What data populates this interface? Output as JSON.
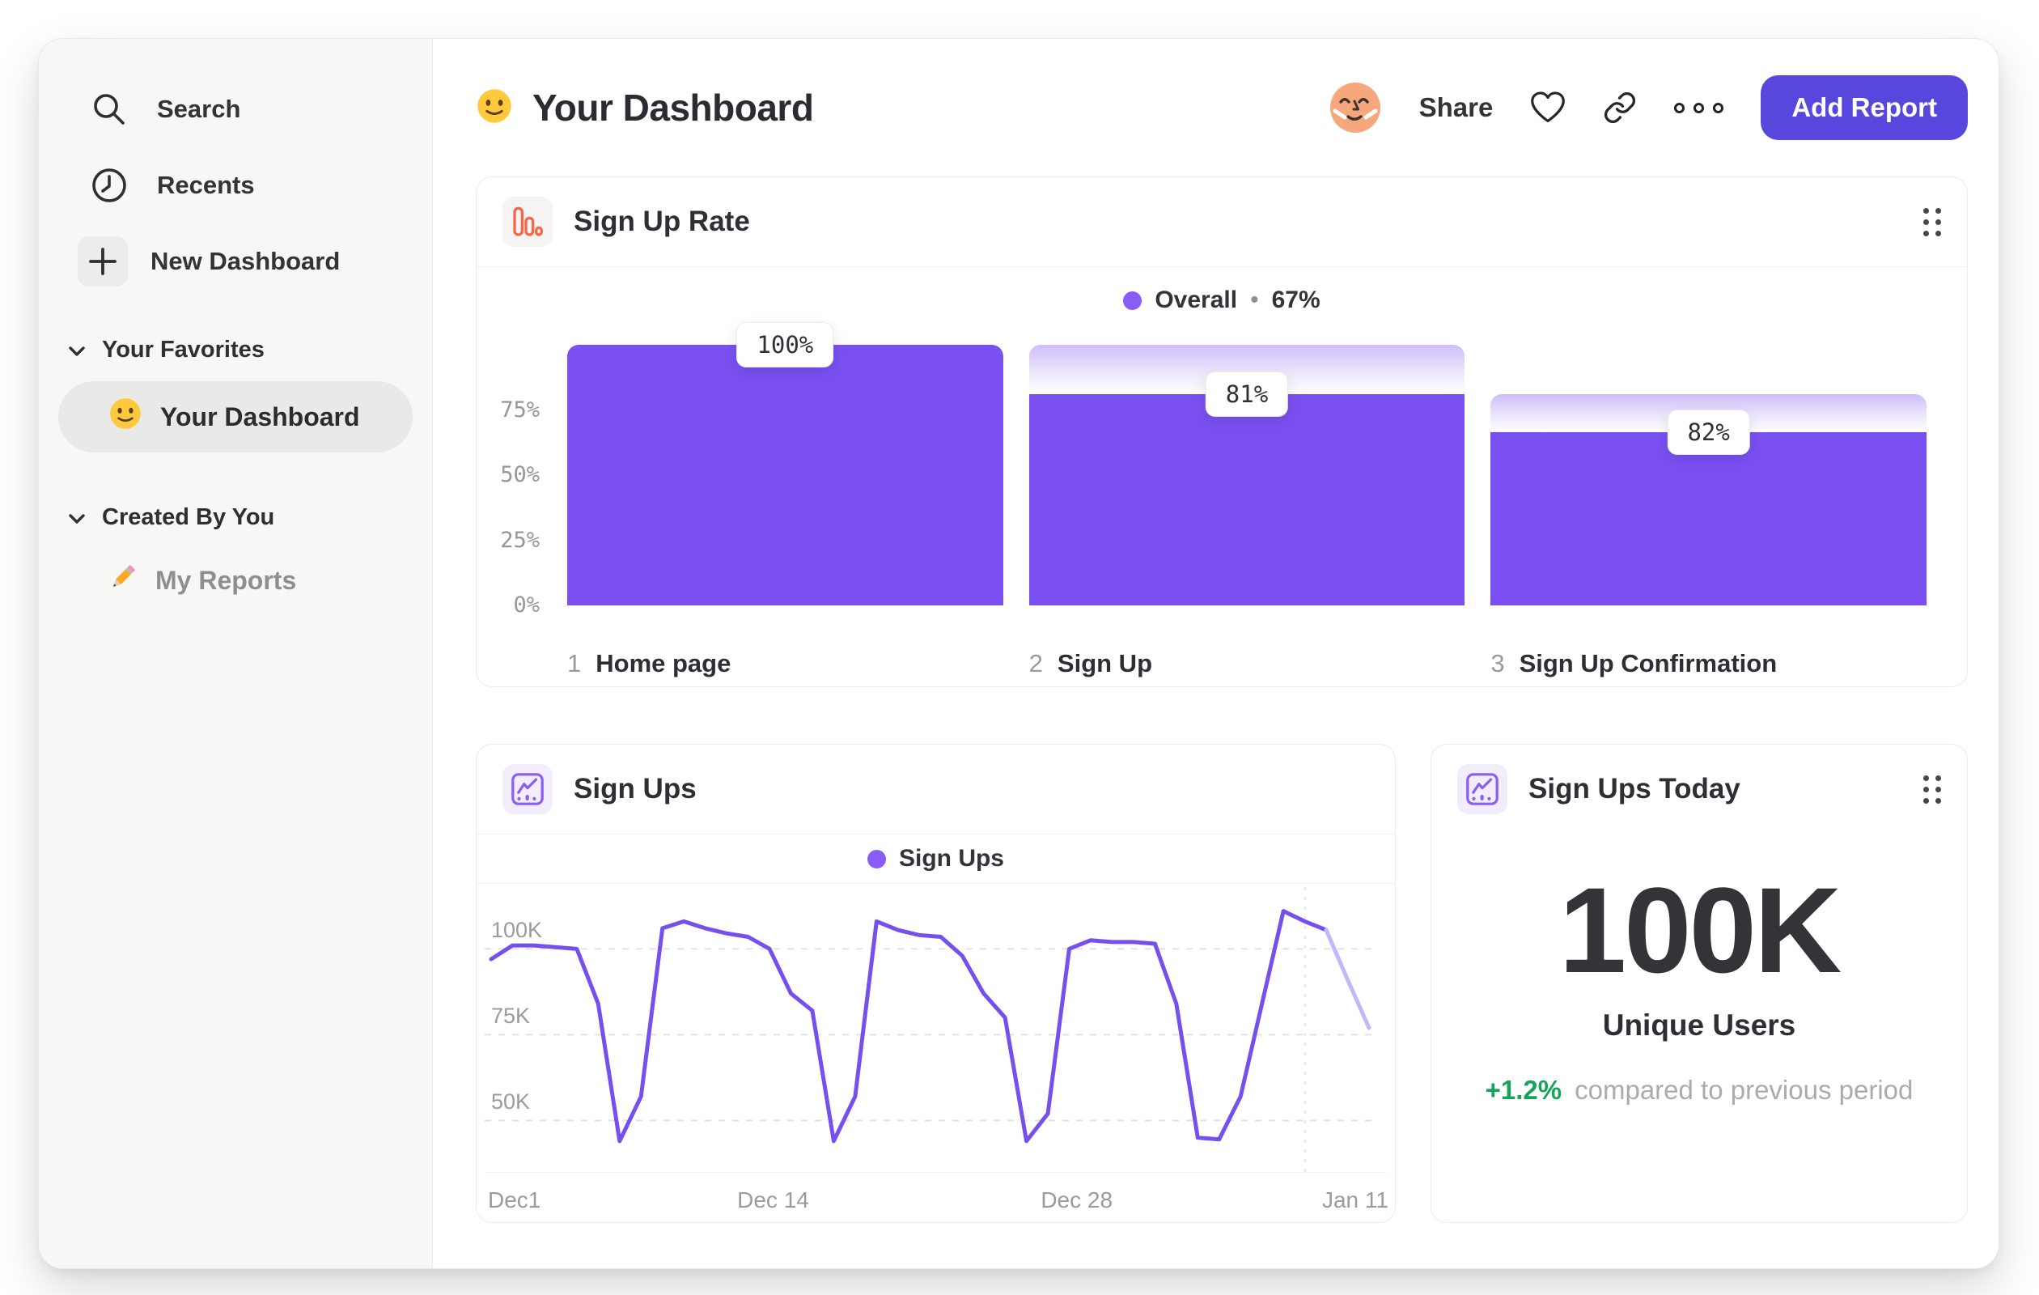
{
  "sidebar": {
    "nav": [
      {
        "label": "Search",
        "icon": "search-icon"
      },
      {
        "label": "Recents",
        "icon": "clock-icon"
      },
      {
        "label": "New Dashboard",
        "icon": "plus-icon"
      }
    ],
    "favorites": {
      "title": "Your Favorites",
      "item": {
        "label": "Your Dashboard",
        "icon": "smiley-emoji",
        "selected": true
      }
    },
    "created": {
      "title": "Created By You",
      "item": {
        "label": "My Reports",
        "icon": "pencil-emoji"
      }
    }
  },
  "header": {
    "title": "Your Dashboard",
    "title_icon": "smiley-emoji",
    "share": "Share",
    "add_report": "Add Report",
    "icons": [
      "avatar",
      "heart-icon",
      "link-icon",
      "more-options-icon"
    ]
  },
  "cards": {
    "funnel": {
      "title": "Sign Up Rate",
      "icon": "funnel-chart-icon",
      "legend": {
        "name": "Overall",
        "sep": "•",
        "value": "67%"
      }
    },
    "line": {
      "title": "Sign Ups",
      "icon": "line-chart-icon",
      "legend": {
        "name": "Sign Ups"
      }
    },
    "metric": {
      "title": "Sign Ups Today",
      "icon": "line-chart-icon",
      "value": "100K",
      "label": "Unique Users",
      "delta": "+1.2%",
      "caption": "compared to previous period"
    }
  },
  "chart_data": [
    {
      "type": "bar",
      "title": "Sign Up Rate",
      "legend": [
        {
          "name": "Overall",
          "value": "67%"
        }
      ],
      "categories": [
        "Home page",
        "Sign Up",
        "Sign Up Confirmation"
      ],
      "step_numbers": [
        "1",
        "2",
        "3"
      ],
      "values": [
        100,
        81,
        82
      ],
      "cumulative_values": [
        100,
        81,
        66.4
      ],
      "value_labels": [
        "100%",
        "81%",
        "82%"
      ],
      "y_ticks": [
        75,
        50,
        25,
        0
      ],
      "y_tick_labels": [
        "75%",
        "50%",
        "25%",
        "0%"
      ],
      "ylim": [
        0,
        100
      ],
      "unit": "%",
      "grid": false,
      "legend_position": "top-center"
    },
    {
      "type": "line",
      "title": "Sign Ups",
      "series": [
        {
          "name": "Sign Ups",
          "values": [
            97,
            101,
            101,
            100.5,
            100,
            84,
            44,
            57,
            106,
            108,
            106,
            104.5,
            103.5,
            100,
            87,
            82,
            44,
            57,
            108,
            105.5,
            104,
            103.5,
            98,
            87,
            80,
            44,
            52,
            100,
            102.5,
            102,
            102,
            101.5,
            84,
            45,
            44.5,
            57,
            84,
            111,
            108,
            105.5,
            91,
            77
          ]
        }
      ],
      "x_start": "Dec1",
      "x_tick_labels": [
        "Dec1",
        "Dec 14",
        "Dec 28",
        "Jan 11"
      ],
      "x_tick_indices": [
        0,
        13,
        27,
        41
      ],
      "y_ticks": [
        100,
        75,
        50
      ],
      "y_tick_labels": [
        "100K",
        "75K",
        "50K"
      ],
      "ylim": [
        35,
        118
      ],
      "unit": "K",
      "grid": "dashed-horizontal",
      "incomplete_period_marker_index": 38,
      "faded_from_index": 39,
      "legend_position": "top-center"
    },
    {
      "type": "metric",
      "title": "Sign Ups Today",
      "value": "100K",
      "label": "Unique Users",
      "delta": "+1.2%",
      "delta_caption": "compared to previous period"
    }
  ],
  "colors": {
    "bar_purple": "#7a50f2",
    "legend_dot": "#8a5cf6",
    "line_stroke": "#7550ef",
    "line_faded": "#c6b5f8",
    "gradient_top": "#cdbdfa",
    "button_purple": "#5847dd",
    "orange_icon": "#f3684a",
    "purple_icon": "#8b5cf6",
    "green_delta": "#16a35a",
    "avatar_skin": "#f7a77c",
    "sidebar_bg": "#f7f7f5"
  }
}
